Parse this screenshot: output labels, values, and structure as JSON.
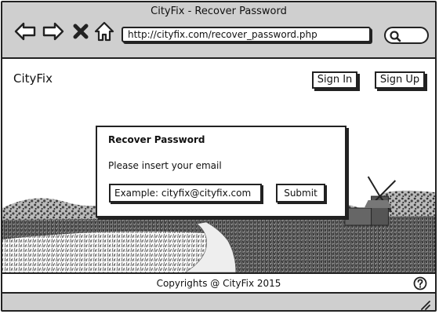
{
  "window": {
    "title": "CityFix - Recover Password"
  },
  "browser": {
    "url": "http://cityfix.com/recover_password.php",
    "nav_icons": [
      "back-arrow-icon",
      "forward-arrow-icon",
      "close-x-icon",
      "home-icon"
    ],
    "search_icon": "search-icon"
  },
  "header": {
    "logo": "CityFix",
    "sign_in": "Sign In",
    "sign_up": "Sign Up"
  },
  "recover": {
    "title": "Recover Password",
    "instruction": "Please insert your email",
    "email_placeholder": "Example: cityfix@cityfix.com",
    "submit": "Submit"
  },
  "footer": {
    "copyright": "Copyrights @ CityFix 2015",
    "help_icon": "help-icon"
  }
}
